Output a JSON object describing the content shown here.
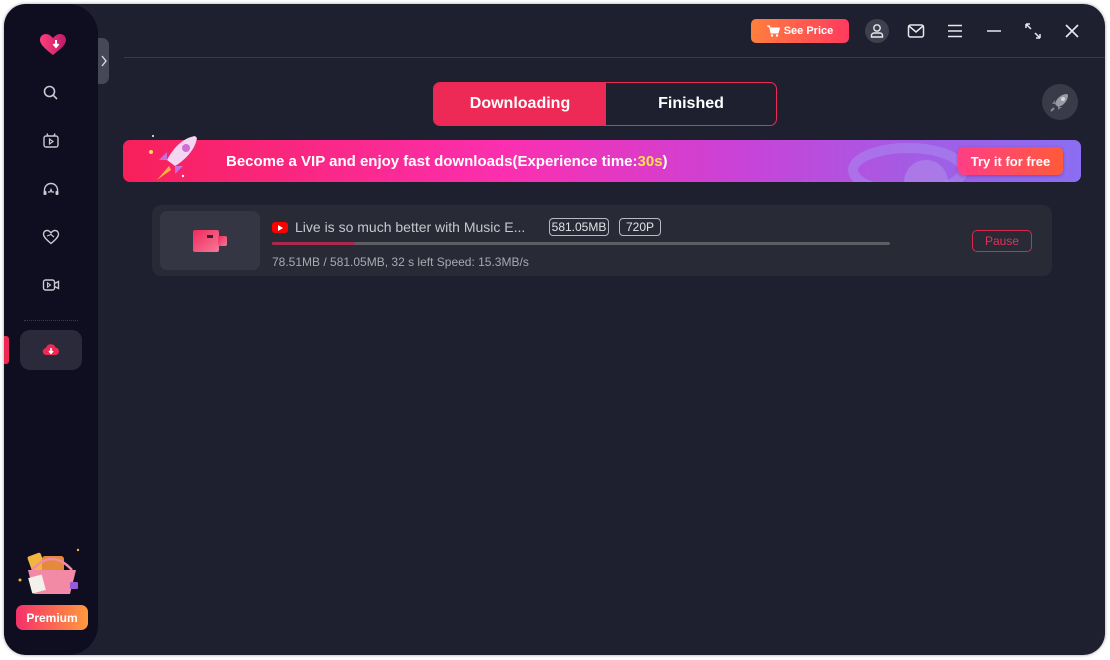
{
  "app": {
    "brand_color": "#ec2a55"
  },
  "sidebar": {
    "logo": "app-logo-heart-download",
    "items": [
      {
        "name": "search",
        "icon": "search-icon",
        "active": false
      },
      {
        "name": "video",
        "icon": "tv-play-icon",
        "active": false
      },
      {
        "name": "music",
        "icon": "headphones-icon",
        "active": false
      },
      {
        "name": "favorites",
        "icon": "heart-icon",
        "active": false
      },
      {
        "name": "recorder",
        "icon": "video-camera-icon",
        "active": false
      },
      {
        "name": "downloads",
        "icon": "cloud-download-icon",
        "active": true
      }
    ],
    "premium_label": "Premium"
  },
  "titlebar": {
    "see_price_label": "See Price",
    "icons": [
      "user-icon",
      "mail-icon",
      "menu-icon",
      "minimize-icon",
      "maximize-icon",
      "close-icon"
    ]
  },
  "tabs": [
    {
      "label": "Downloading",
      "active": true
    },
    {
      "label": "Finished",
      "active": false
    }
  ],
  "banner": {
    "text_before": "Become a VIP and enjoy fast downloads(Experience time: ",
    "highlight": "30s",
    "text_after": ")",
    "cta_label": "Try it for free"
  },
  "downloads": [
    {
      "source": "youtube",
      "title": "Live is so much better with Music E...",
      "size": "581.05MB",
      "quality": "720P",
      "progress": 0.135,
      "status": "78.51MB / 581.05MB, 32 s left Speed: 15.3MB/s",
      "action_label": "Pause"
    }
  ]
}
